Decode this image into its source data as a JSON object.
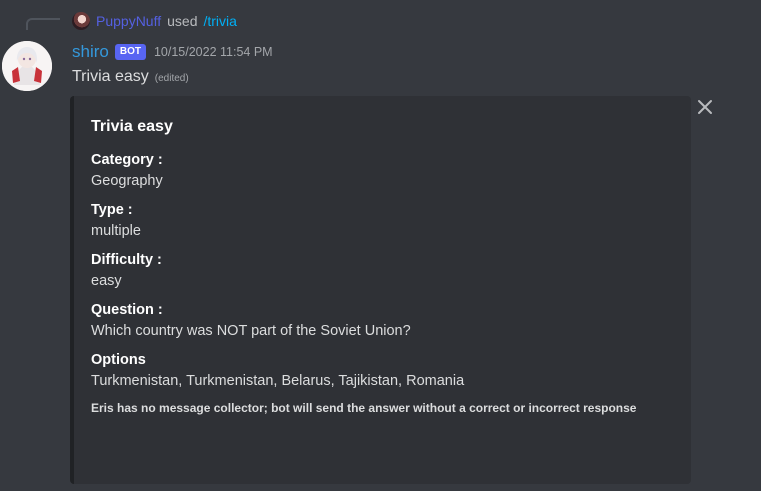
{
  "reply": {
    "username": "PuppyNuff",
    "used_text": "used",
    "command": "/trivia"
  },
  "message": {
    "username": "shiro",
    "bot_tag": "BOT",
    "timestamp": "10/15/2022 11:54 PM",
    "content": "Trivia easy",
    "edited": "(edited)"
  },
  "embed": {
    "title": "Trivia easy",
    "fields": [
      {
        "name": "Category :",
        "value": "Geography"
      },
      {
        "name": "Type :",
        "value": "multiple"
      },
      {
        "name": "Difficulty :",
        "value": "easy"
      },
      {
        "name": "Question :",
        "value": "Which country was NOT part of the Soviet Union?"
      },
      {
        "name": "Options",
        "value": "Turkmenistan, Turkmenistan, Belarus, Tajikistan, Romania"
      }
    ],
    "footer": "Eris has no message collector; bot will send the answer without a correct or incorrect response"
  },
  "icons": {
    "close": "close-icon",
    "reply_avatar": "user-avatar-icon",
    "bot_avatar": "bot-avatar-icon"
  },
  "colors": {
    "background": "#36393f",
    "embed_background": "#2f3136",
    "username": "#3498db",
    "bot_tag": "#5865f2",
    "command": "#00aff4"
  }
}
